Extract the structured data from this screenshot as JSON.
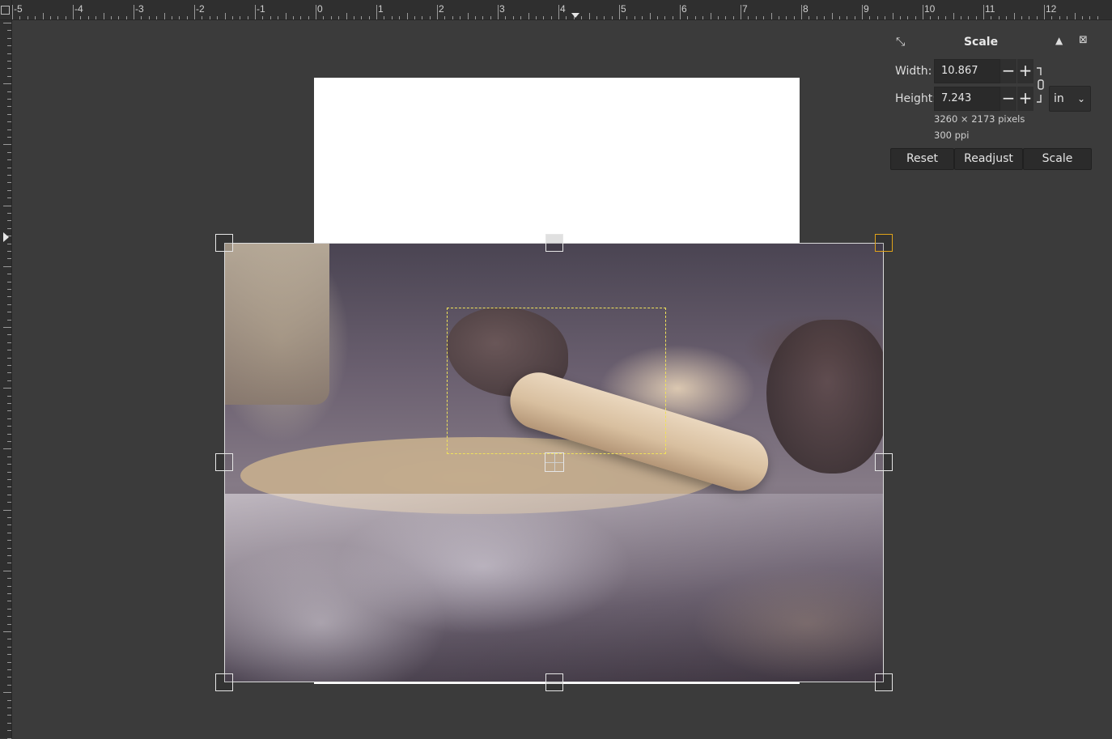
{
  "ruler": {
    "horizontal_labels": [
      "-5",
      "-4",
      "-3",
      "-2",
      "-1",
      "0",
      "1",
      "2",
      "3",
      "4",
      "5",
      "6",
      "7",
      "8",
      "9",
      "10",
      "11",
      "12"
    ],
    "unit": "in"
  },
  "canvas": {
    "page_color": "#ffffff",
    "image_description_icon": "photo-layer"
  },
  "scale_dialog": {
    "title": "Scale",
    "width_label": "Width:",
    "width_value": "10.867",
    "height_label": "Height:",
    "height_value": "7.243",
    "unit": "in",
    "pixel_size": "3260 × 2173 pixels",
    "resolution": "300 ppi",
    "buttons": {
      "reset": "Reset",
      "readjust": "Readjust",
      "scale": "Scale"
    },
    "spin_minus": "−",
    "spin_plus": "+",
    "unit_caret": "⌄"
  },
  "colors": {
    "background": "#3b3b3b",
    "ruler": "#2f2f2f",
    "active_handle": "#e0a31a",
    "selection": "#f0e25a"
  }
}
